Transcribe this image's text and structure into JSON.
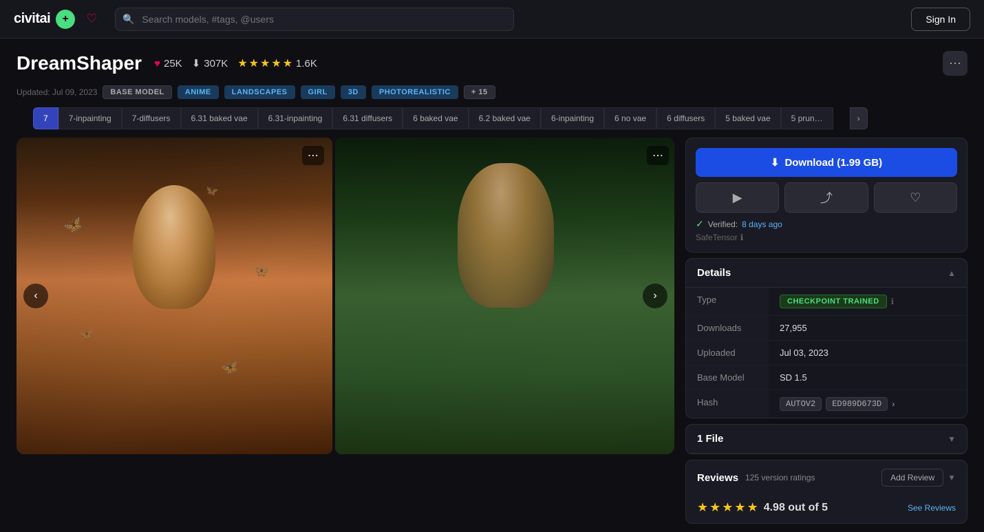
{
  "header": {
    "logo_text": "civitai",
    "logo_plus": "+",
    "search_placeholder": "Search models, #tags, @users",
    "sign_in": "Sign In"
  },
  "model": {
    "title": "DreamShaper",
    "likes": "25K",
    "downloads": "307K",
    "ratings": "1.6K",
    "updated": "Updated: Jul 09, 2023",
    "tags": [
      "BASE MODEL",
      "ANIME",
      "LANDSCAPES",
      "GIRL",
      "3D",
      "PHOTOREALISTIC",
      "+ 15"
    ]
  },
  "version_tabs": [
    {
      "label": "7",
      "active": true
    },
    {
      "label": "7-inpainting",
      "active": false
    },
    {
      "label": "7-diffusers",
      "active": false
    },
    {
      "label": "6.31 baked vae",
      "active": false
    },
    {
      "label": "6.31-inpainting",
      "active": false
    },
    {
      "label": "6.31 diffusers",
      "active": false
    },
    {
      "label": "6 baked vae",
      "active": false
    },
    {
      "label": "6.2 baked vae",
      "active": false
    },
    {
      "label": "6-inpainting",
      "active": false
    },
    {
      "label": "6 no vae",
      "active": false
    },
    {
      "label": "6 diffusers",
      "active": false
    },
    {
      "label": "5 baked vae",
      "active": false
    },
    {
      "label": "5 prun…",
      "active": false
    }
  ],
  "download": {
    "button_label": "Download (1.99 GB)",
    "verified_text": "Verified:",
    "verified_link": "8 days ago",
    "safetensor_label": "SafeTensor",
    "icons": {
      "download": "⬇",
      "play": "▶",
      "share": "⤴",
      "heart": "♡"
    }
  },
  "details": {
    "section_title": "Details",
    "type_label": "Type",
    "type_value": "CHECKPOINT TRAINED",
    "downloads_label": "Downloads",
    "downloads_value": "27,955",
    "uploaded_label": "Uploaded",
    "uploaded_value": "Jul 03, 2023",
    "base_model_label": "Base Model",
    "base_model_value": "SD 1.5",
    "hash_label": "Hash",
    "hash_autov2": "AUTOV2",
    "hash_value": "ED989D673D",
    "hash_arrow": "›"
  },
  "file_section": {
    "title": "1 File"
  },
  "reviews": {
    "title": "Reviews",
    "version_ratings": "125 version ratings",
    "add_review": "Add Review",
    "see_reviews": "See Reviews",
    "score": "4.98 out of 5"
  }
}
